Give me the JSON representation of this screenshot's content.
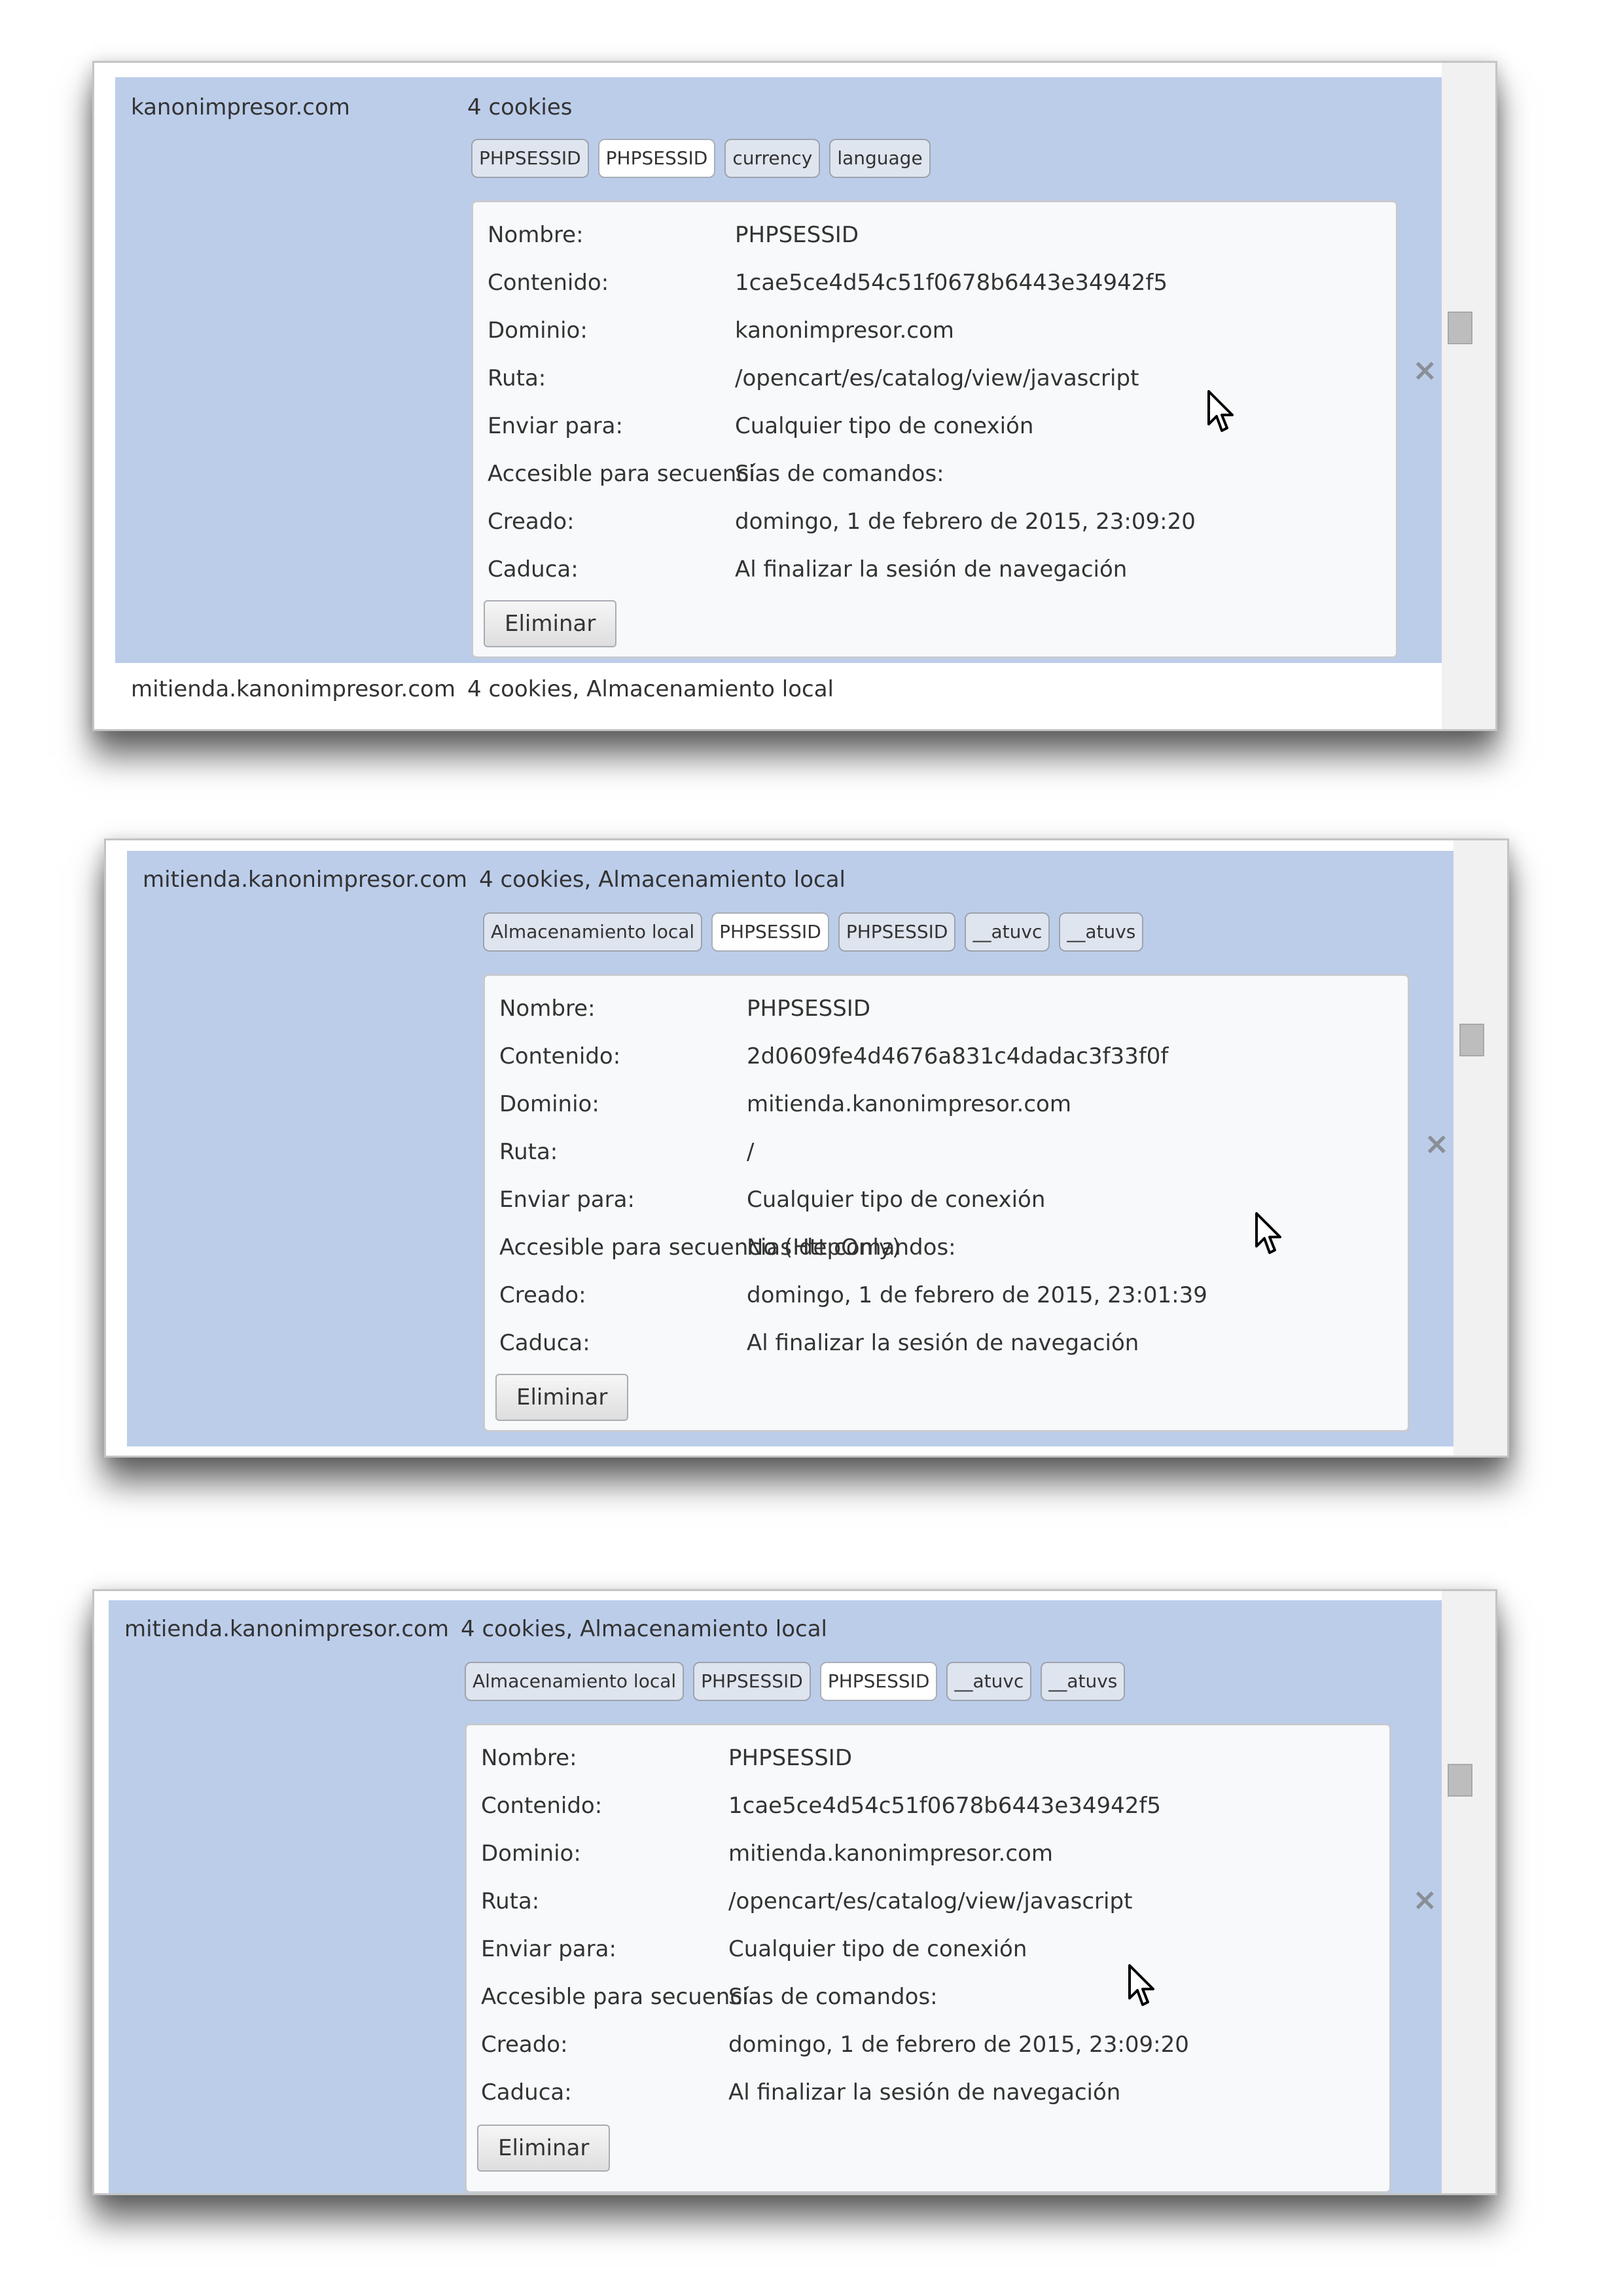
{
  "panel1": {
    "site": "kanonimpresor.com",
    "summary": "4 cookies",
    "chips": [
      "PHPSESSID",
      "PHPSESSID",
      "currency",
      "language"
    ],
    "labels": [
      "Nombre:",
      "Contenido:",
      "Dominio:",
      "Ruta:",
      "Enviar para:",
      "Accesible para secuencias de comandos:",
      "Creado:",
      "Caduca:"
    ],
    "values": [
      "PHPSESSID",
      "1cae5ce4d54c51f0678b6443e34942f5",
      "kanonimpresor.com",
      "/opencart/es/catalog/view/javascript",
      "Cualquier tipo de conexión",
      "Sí",
      "domingo, 1 de febrero de 2015, 23:09:20",
      "Al finalizar la sesión de navegación"
    ],
    "delete_label": "Eliminar",
    "next_site": "mitienda.kanonimpresor.com",
    "next_summary": "4 cookies, Almacenamiento local"
  },
  "panel2": {
    "site": "mitienda.kanonimpresor.com",
    "summary": "4 cookies, Almacenamiento local",
    "chips": [
      "Almacenamiento local",
      "PHPSESSID",
      "PHPSESSID",
      "__atuvc",
      "__atuvs"
    ],
    "labels": [
      "Nombre:",
      "Contenido:",
      "Dominio:",
      "Ruta:",
      "Enviar para:",
      "Accesible para secuencias de comandos:",
      "Creado:",
      "Caduca:"
    ],
    "values": [
      "PHPSESSID",
      "2d0609fe4d4676a831c4dadac3f33f0f",
      "mitienda.kanonimpresor.com",
      "/",
      "Cualquier tipo de conexión",
      "No (HttpOnly)",
      "domingo, 1 de febrero de 2015, 23:01:39",
      "Al finalizar la sesión de navegación"
    ],
    "delete_label": "Eliminar"
  },
  "panel3": {
    "site": "mitienda.kanonimpresor.com",
    "summary": "4 cookies, Almacenamiento local",
    "chips": [
      "Almacenamiento local",
      "PHPSESSID",
      "PHPSESSID",
      "__atuvc",
      "__atuvs"
    ],
    "labels": [
      "Nombre:",
      "Contenido:",
      "Dominio:",
      "Ruta:",
      "Enviar para:",
      "Accesible para secuencias de comandos:",
      "Creado:",
      "Caduca:"
    ],
    "values": [
      "PHPSESSID",
      "1cae5ce4d54c51f0678b6443e34942f5",
      "mitienda.kanonimpresor.com",
      "/opencart/es/catalog/view/javascript",
      "Cualquier tipo de conexión",
      "Sí",
      "domingo, 1 de febrero de 2015, 23:09:20",
      "Al finalizar la sesión de navegación"
    ],
    "delete_label": "Eliminar"
  },
  "icons": {
    "close": "close-icon",
    "cursor": "mouse-cursor-icon",
    "scrollbar": "scrollbar-thumb"
  },
  "colors": {
    "selected_row": "#bccdea",
    "detail_bg": "#f7f9fb",
    "chip_border": "#9da3ad"
  }
}
